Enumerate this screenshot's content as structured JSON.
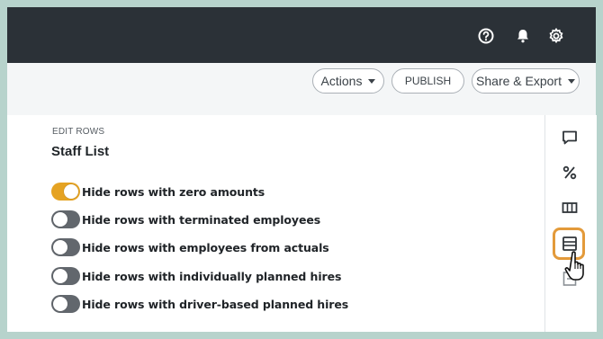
{
  "header": {
    "icons": [
      "help-icon",
      "bell-icon",
      "gear-icon"
    ]
  },
  "toolbar": {
    "actions_label": "Actions",
    "publish_label": "PUBLISH",
    "share_label": "Share & Export"
  },
  "panel": {
    "section_label": "EDIT ROWS",
    "title": "Staff List",
    "toggles": [
      {
        "label": "Hide rows with zero amounts",
        "on": true
      },
      {
        "label": "Hide rows with terminated employees",
        "on": false
      },
      {
        "label": "Hide rows with employees from actuals",
        "on": false
      },
      {
        "label": "Hide rows with individually planned hires",
        "on": false
      },
      {
        "label": "Hide rows with driver-based planned hires",
        "on": false
      }
    ]
  },
  "sidebar": {
    "icons": [
      "comment-icon",
      "percent-icon",
      "columns-icon",
      "rows-icon",
      "export-icon"
    ]
  },
  "colors": {
    "topbar": "#2b3137",
    "toggle_on": "#e5a323",
    "toggle_off": "#62676d",
    "highlight": "#e39a3a",
    "background": "#b7d3cc"
  }
}
